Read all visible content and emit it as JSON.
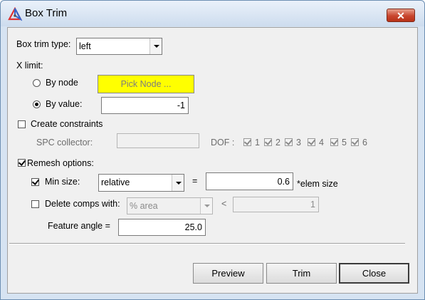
{
  "window": {
    "title": "Box Trim"
  },
  "box_trim_type": {
    "label": "Box trim type:",
    "value": "left"
  },
  "x_limit": {
    "label": "X limit:",
    "by_node": {
      "label": "By node",
      "selected": false,
      "button_label": "Pick Node ..."
    },
    "by_value": {
      "label": "By value:",
      "selected": true,
      "value": "-1"
    }
  },
  "constraints": {
    "create_label": "Create constraints",
    "create_checked": false,
    "spc_collector_label": "SPC collector:",
    "spc_collector_value": "",
    "dof_label": "DOF :",
    "dofs": [
      {
        "label": "1",
        "checked": true
      },
      {
        "label": "2",
        "checked": true
      },
      {
        "label": "3",
        "checked": true
      },
      {
        "label": "4",
        "checked": true
      },
      {
        "label": "5",
        "checked": true
      },
      {
        "label": "6",
        "checked": false
      }
    ]
  },
  "remesh": {
    "label": "Remesh options:",
    "checked": true,
    "min_size": {
      "label": "Min size:",
      "checked": true,
      "mode": "relative",
      "equals": "=",
      "value": "0.6",
      "unit": "*elem size"
    },
    "delete_comps": {
      "label": "Delete comps with:",
      "checked": false,
      "mode": "% area",
      "lt": "<",
      "value": "1"
    },
    "feature_angle": {
      "label": "Feature angle =",
      "value": "25.0"
    }
  },
  "buttons": {
    "preview": "Preview",
    "trim": "Trim",
    "close": "Close"
  },
  "icons": {
    "app": "hypermesh-triangle-icon",
    "close": "close-x-icon"
  },
  "colors": {
    "pick_button_bg": "#ffff00",
    "close_button": "#c8452e",
    "titlebar": "#d6e3f2"
  }
}
